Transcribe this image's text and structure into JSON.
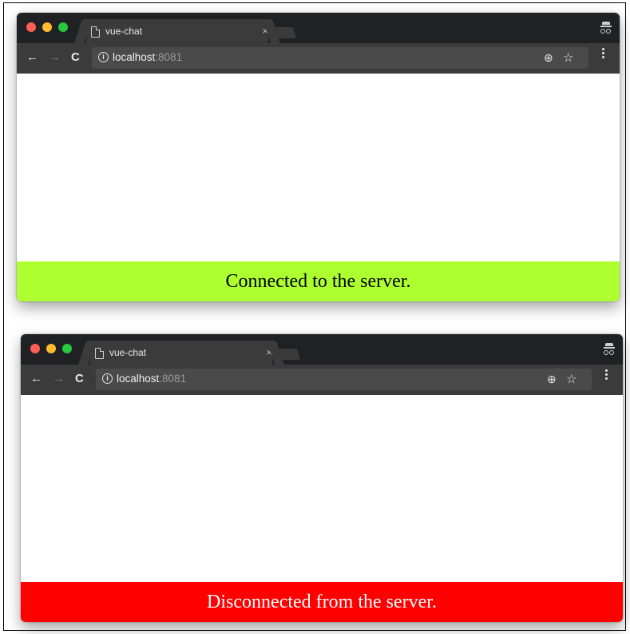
{
  "windows": [
    {
      "tab_title": "vue-chat",
      "tab_close": "×",
      "address_host": "localhost",
      "address_port": ":8081",
      "status_text": "Connected to the server.",
      "status_color": "#adff2f",
      "status_text_color": "#000000"
    },
    {
      "tab_title": "vue-chat",
      "tab_close": "×",
      "address_host": "localhost",
      "address_port": ":8081",
      "status_text": "Disconnected from the server.",
      "status_color": "#ff0000",
      "status_text_color": "#ffffff"
    }
  ],
  "icons": {
    "back": "←",
    "forward": "→",
    "reload": "C",
    "zoom": "⊕",
    "star": "☆",
    "info": "i"
  }
}
